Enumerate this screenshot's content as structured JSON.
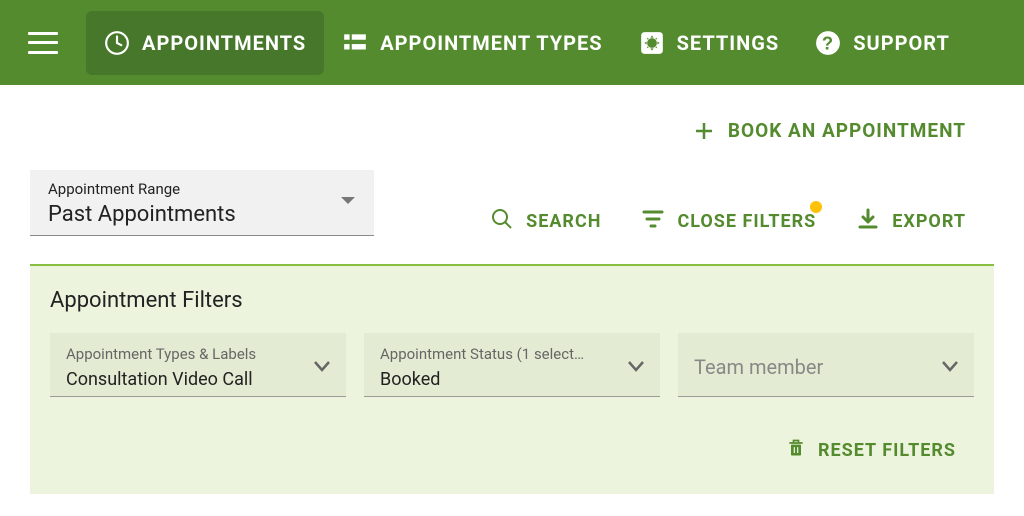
{
  "nav": {
    "items": [
      {
        "label": "APPOINTMENTS",
        "icon": "clock",
        "active": true
      },
      {
        "label": "APPOINTMENT TYPES",
        "icon": "grid",
        "active": false
      },
      {
        "label": "SETTINGS",
        "icon": "gear",
        "active": false
      },
      {
        "label": "SUPPORT",
        "icon": "help",
        "active": false
      }
    ]
  },
  "book_button": "BOOK AN APPOINTMENT",
  "range": {
    "label": "Appointment Range",
    "value": "Past Appointments"
  },
  "toolbar": {
    "search": "SEARCH",
    "close_filters": "CLOSE FILTERS",
    "export": "EXPORT",
    "filters_badge": true
  },
  "filters": {
    "title": "Appointment Filters",
    "items": [
      {
        "label": "Appointment Types & Labels",
        "value": "Consultation Video Call"
      },
      {
        "label": "Appointment Status (1 select…",
        "value": "Booked"
      },
      {
        "label": "",
        "value": "Team member",
        "placeholder": true
      }
    ],
    "reset": "RESET FILTERS"
  }
}
